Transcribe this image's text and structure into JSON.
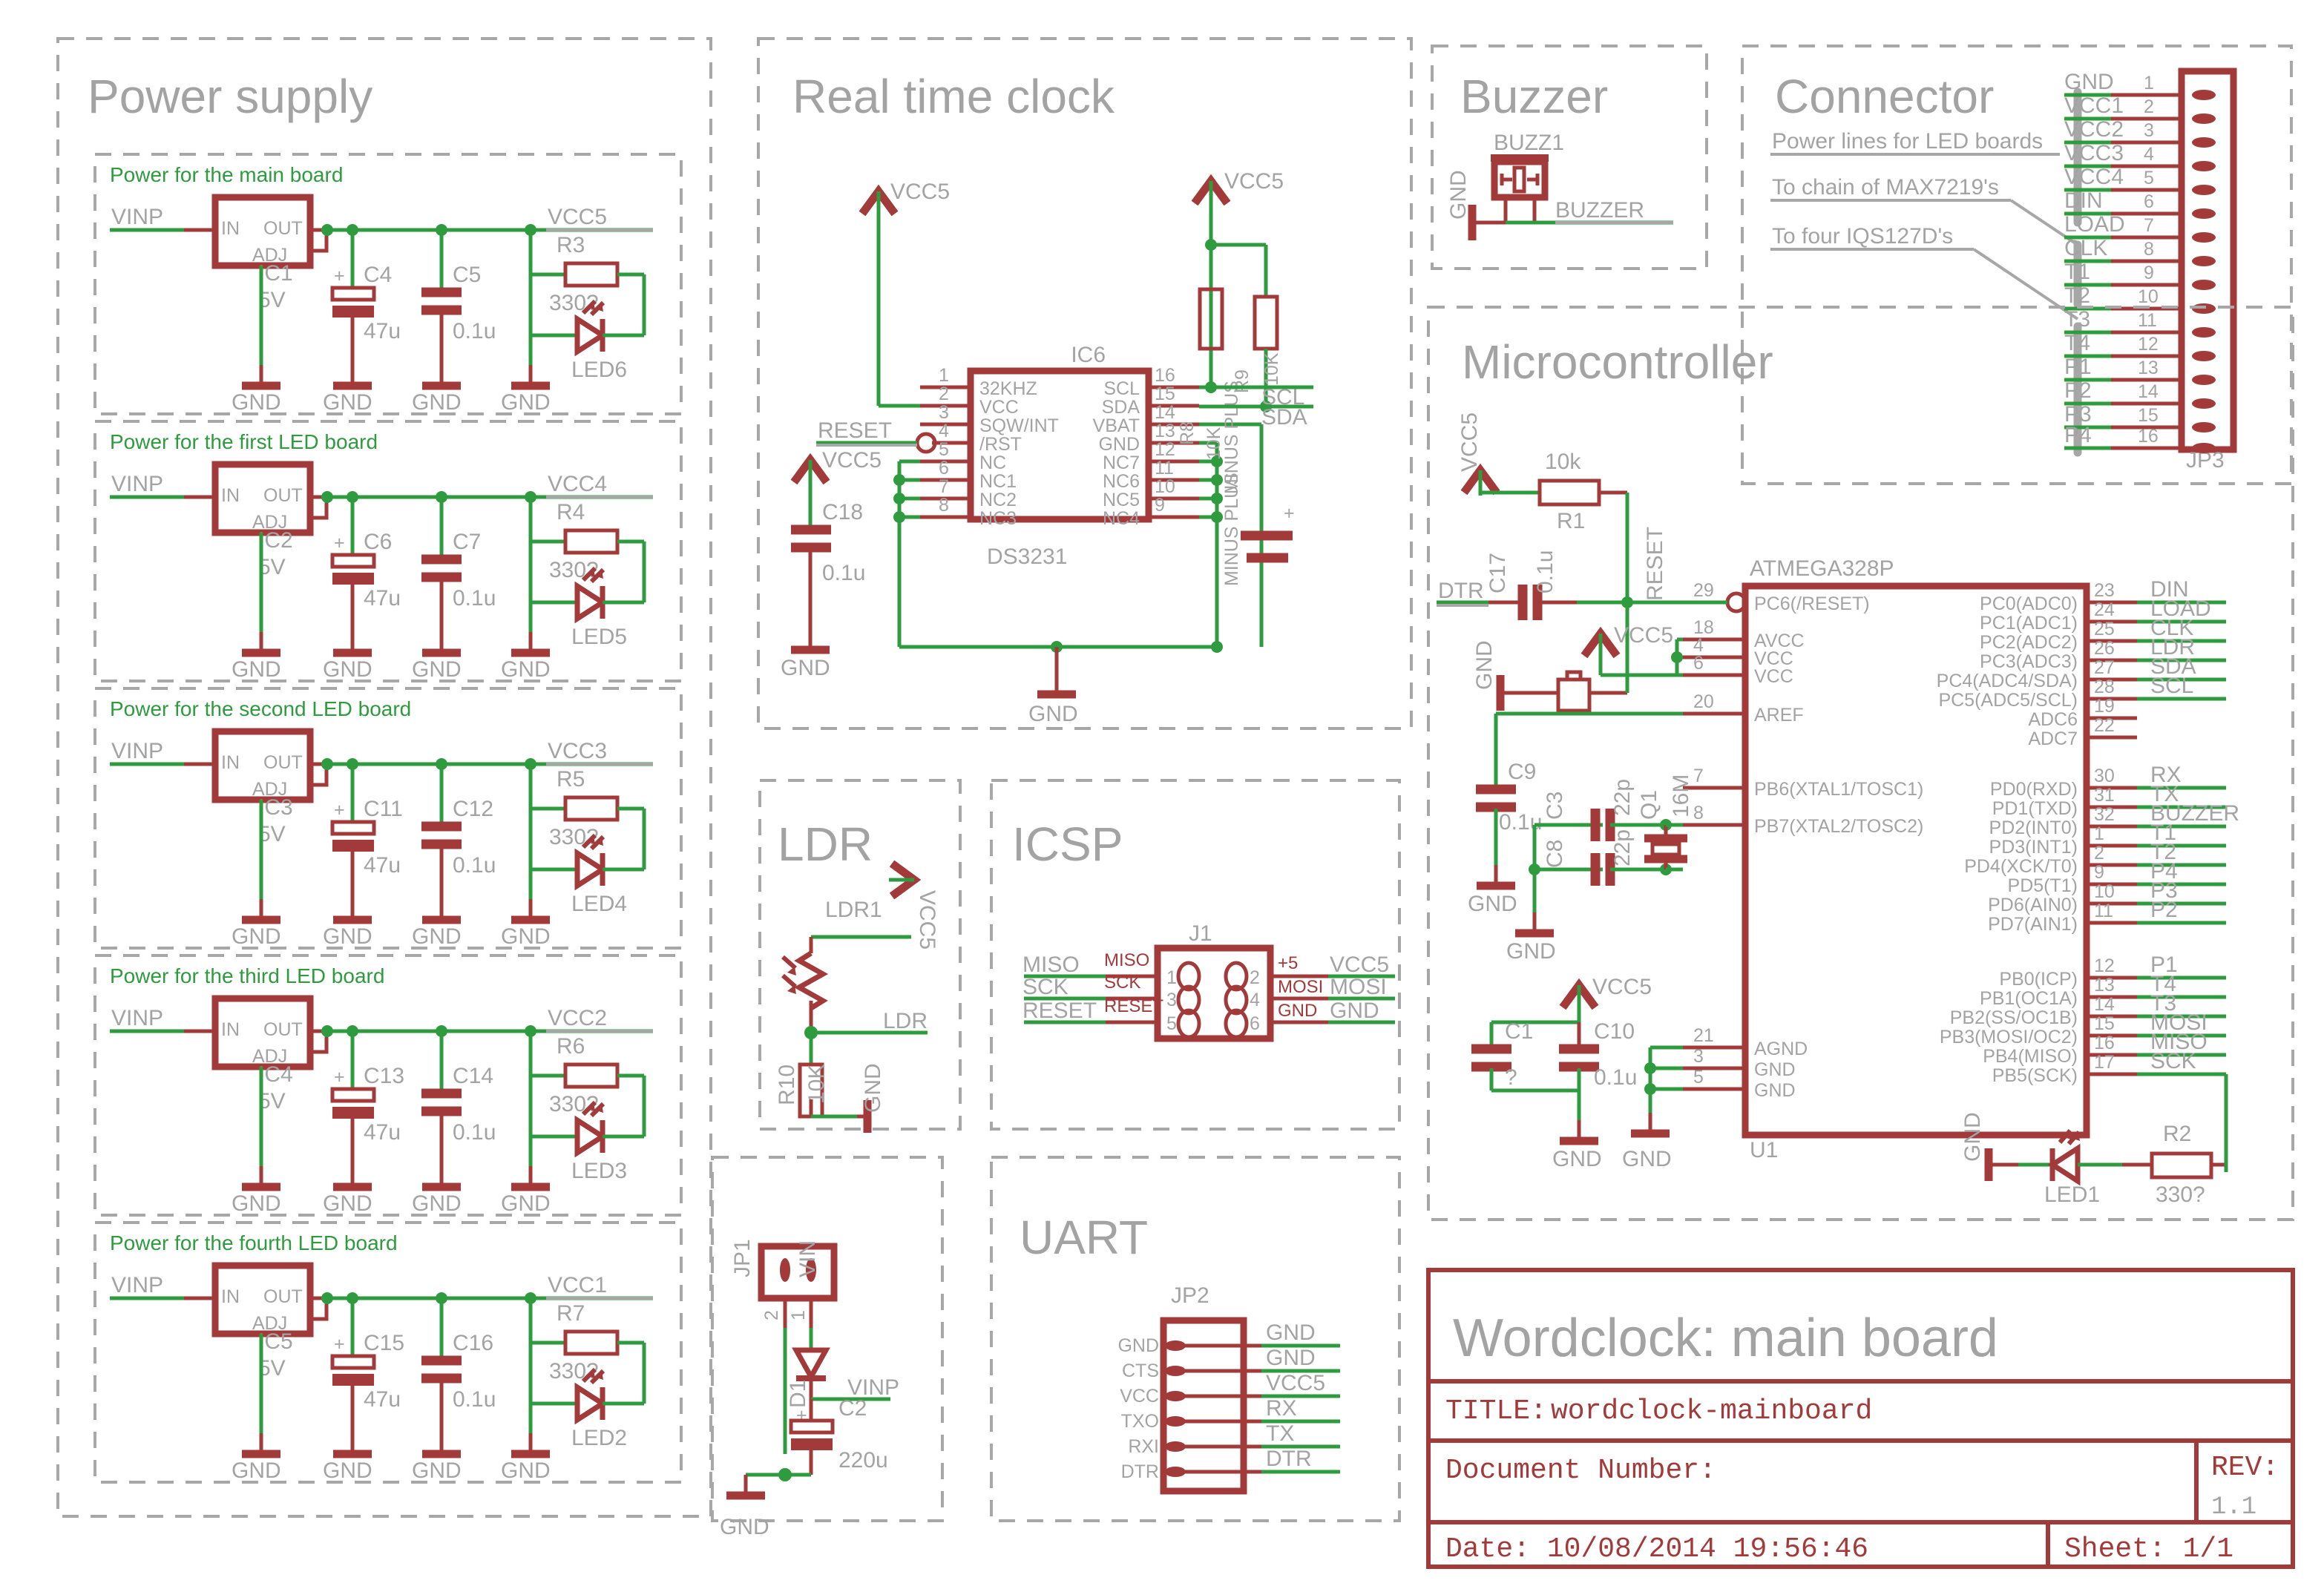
{
  "sheet": {
    "title_big": "Wordclock: main board",
    "title_label": "TITLE:",
    "title_value": "wordclock-mainboard",
    "docnum_label": "Document Number:",
    "rev_label": "REV:",
    "rev_value": "1.1",
    "date_line": "Date: 10/08/2014 19:56:46",
    "sheet_line": "Sheet: 1/1"
  },
  "colors": {
    "wire_red": "#a23a3a",
    "wire_green": "#2e9b3e",
    "text_gray": "#a3a3a3",
    "frame_dash": "#a7a7a7"
  },
  "sections": {
    "power_supply": "Power supply",
    "real_time_clock": "Real time clock",
    "buzzer": "Buzzer",
    "connector": "Connector",
    "microcontroller": "Microcontroller",
    "ldr": "LDR",
    "icsp": "ICSP",
    "uart": "UART"
  },
  "power_blocks": [
    {
      "caption": "Power for the main board",
      "in": "VINP",
      "out": "VCC5",
      "ic": "IC1",
      "icv": "5V",
      "cbig": "C4",
      "cbigv": "47u",
      "csm": "C5",
      "csmv": "0.1u",
      "r": "R3",
      "rv": "330?",
      "led": "LED6",
      "gnd": "GND"
    },
    {
      "caption": "Power for the first LED board",
      "in": "VINP",
      "out": "VCC4",
      "ic": "IC2",
      "icv": "5V",
      "cbig": "C6",
      "cbigv": "47u",
      "csm": "C7",
      "csmv": "0.1u",
      "r": "R4",
      "rv": "330?",
      "led": "LED5",
      "gnd": "GND"
    },
    {
      "caption": "Power for the second LED board",
      "in": "VINP",
      "out": "VCC3",
      "ic": "IC3",
      "icv": "5V",
      "cbig": "C11",
      "cbigv": "47u",
      "csm": "C12",
      "csmv": "0.1u",
      "r": "R5",
      "rv": "330?",
      "led": "LED4",
      "gnd": "GND"
    },
    {
      "caption": "Power for the third LED board",
      "in": "VINP",
      "out": "VCC2",
      "ic": "IC4",
      "icv": "5V",
      "cbig": "C13",
      "cbigv": "47u",
      "csm": "C14",
      "csmv": "0.1u",
      "r": "R6",
      "rv": "330?",
      "led": "LED3",
      "gnd": "GND"
    },
    {
      "caption": "Power for the fourth LED board",
      "in": "VINP",
      "out": "VCC1",
      "ic": "IC5",
      "icv": "5V",
      "cbig": "C15",
      "cbigv": "47u",
      "csm": "C16",
      "csmv": "0.1u",
      "r": "R7",
      "rv": "330?",
      "led": "LED2",
      "gnd": "GND"
    }
  ],
  "regulator_pins": {
    "in": "IN",
    "out": "OUT",
    "adj": "ADJ"
  },
  "rtc": {
    "ref": "IC6",
    "part": "DS3231",
    "vcc_top": "VCC5",
    "vcc_left": "VCC5",
    "vcc_cap": "VCC5",
    "reset": "RESET",
    "cap": "C18",
    "capv": "0.1u",
    "gnd": "GND",
    "gnd2": "GND",
    "r8": "R8",
    "r8v": "10K",
    "r9": "R9",
    "r9v": "10K",
    "scl": "SCL",
    "sda": "SDA",
    "bat_plus": "MINUS PLUS",
    "bat_minus": "MINUS PLUS",
    "left_pins": [
      {
        "n": "1",
        "name": "32KHZ"
      },
      {
        "n": "2",
        "name": "VCC"
      },
      {
        "n": "3",
        "name": "SQW/INT"
      },
      {
        "n": "4",
        "name": "/RST"
      },
      {
        "n": "5",
        "name": "NC"
      },
      {
        "n": "6",
        "name": "NC1"
      },
      {
        "n": "7",
        "name": "NC2"
      },
      {
        "n": "8",
        "name": "NC3"
      }
    ],
    "right_pins": [
      {
        "n": "16",
        "name": "SCL"
      },
      {
        "n": "15",
        "name": "SDA"
      },
      {
        "n": "14",
        "name": "VBAT"
      },
      {
        "n": "13",
        "name": "GND"
      },
      {
        "n": "12",
        "name": "NC7"
      },
      {
        "n": "11",
        "name": "NC6"
      },
      {
        "n": "10",
        "name": "NC5"
      },
      {
        "n": "9",
        "name": "NC4"
      }
    ]
  },
  "buzzer": {
    "ref": "BUZZ1",
    "gnd": "GND",
    "net": "BUZZER"
  },
  "connector": {
    "ref": "JP3",
    "notes": [
      "Power lines for LED boards",
      "To chain of MAX7219's",
      "To four IQS127D's"
    ],
    "pins": [
      {
        "name": "GND",
        "n": "1"
      },
      {
        "name": "VCC1",
        "n": "2"
      },
      {
        "name": "VCC2",
        "n": "3"
      },
      {
        "name": "VCC3",
        "n": "4"
      },
      {
        "name": "VCC4",
        "n": "5"
      },
      {
        "name": "DIN",
        "n": "6"
      },
      {
        "name": "LOAD",
        "n": "7"
      },
      {
        "name": "CLK",
        "n": "8"
      },
      {
        "name": "T1",
        "n": "9"
      },
      {
        "name": "T2",
        "n": "10"
      },
      {
        "name": "T3",
        "n": "11"
      },
      {
        "name": "T4",
        "n": "12"
      },
      {
        "name": "P1",
        "n": "13"
      },
      {
        "name": "P2",
        "n": "14"
      },
      {
        "name": "P3",
        "n": "15"
      },
      {
        "name": "P4",
        "n": "16"
      }
    ]
  },
  "mcu": {
    "ref": "U1",
    "part": "ATMEGA328P",
    "reset_net": "RESET",
    "dtr_net": "DTR",
    "vcc_reset": "VCC5",
    "vcc_supply": "VCC5",
    "vcc_xtal": "VCC5",
    "vcc_decouple": "VCC5",
    "r1": "R1",
    "r1v": "10k",
    "c17": "C17",
    "c17v": "0.1u",
    "gnd_r1": "GND",
    "c9": "C9",
    "c9v": "0.1u",
    "c3": "C3",
    "c3v": "22p",
    "c8": "C8",
    "c8v": "22p",
    "q1": "Q1",
    "q1v": "16M",
    "gnd_c9": "GND",
    "gnd_xtal": "GND",
    "c1": "C1",
    "c1v": "?",
    "c10": "C10",
    "c10v": "0.1u",
    "gnd_c10": "GND",
    "gnd_agnd": "GND",
    "r2": "R2",
    "r2v": "330?",
    "led1": "LED1",
    "gnd_led1": "GND",
    "left_pins": [
      {
        "n": "29",
        "name": "PC6(/RESET)",
        "inv": true
      },
      {
        "n": "18",
        "name": "AVCC"
      },
      {
        "n": "4",
        "name": "VCC"
      },
      {
        "n": "6",
        "name": "VCC"
      },
      {
        "n": "20",
        "name": "AREF"
      },
      {
        "n": "7",
        "name": "PB6(XTAL1/TOSC1)"
      },
      {
        "n": "8",
        "name": "PB7(XTAL2/TOSC2)"
      },
      {
        "n": "21",
        "name": "AGND"
      },
      {
        "n": "3",
        "name": "GND"
      },
      {
        "n": "5",
        "name": "GND"
      }
    ],
    "right_pins": [
      {
        "n": "23",
        "name": "PC0(ADC0)",
        "net": "DIN"
      },
      {
        "n": "24",
        "name": "PC1(ADC1)",
        "net": "LOAD"
      },
      {
        "n": "25",
        "name": "PC2(ADC2)",
        "net": "CLK"
      },
      {
        "n": "26",
        "name": "PC3(ADC3)",
        "net": "LDR"
      },
      {
        "n": "27",
        "name": "PC4(ADC4/SDA)",
        "net": "SDA"
      },
      {
        "n": "28",
        "name": "PC5(ADC5/SCL)",
        "net": "SCL"
      },
      {
        "n": "19",
        "name": "ADC6",
        "net": ""
      },
      {
        "n": "22",
        "name": "ADC7",
        "net": ""
      },
      {
        "n": "30",
        "name": "PD0(RXD)",
        "net": "RX"
      },
      {
        "n": "31",
        "name": "PD1(TXD)",
        "net": "TX"
      },
      {
        "n": "32",
        "name": "PD2(INT0)",
        "net": "BUZZER"
      },
      {
        "n": "1",
        "name": "PD3(INT1)",
        "net": "T1"
      },
      {
        "n": "2",
        "name": "PD4(XCK/T0)",
        "net": "T2"
      },
      {
        "n": "9",
        "name": "PD5(T1)",
        "net": "P4"
      },
      {
        "n": "10",
        "name": "PD6(AIN0)",
        "net": "P3"
      },
      {
        "n": "11",
        "name": "PD7(AIN1)",
        "net": "P2"
      },
      {
        "n": "12",
        "name": "PB0(ICP)",
        "net": "P1"
      },
      {
        "n": "13",
        "name": "PB1(OC1A)",
        "net": "T4"
      },
      {
        "n": "14",
        "name": "PB2(SS/OC1B)",
        "net": "T3"
      },
      {
        "n": "15",
        "name": "PB3(MOSI/OC2)",
        "net": "MOSI"
      },
      {
        "n": "16",
        "name": "PB4(MISO)",
        "net": "MISO"
      },
      {
        "n": "17",
        "name": "PB5(SCK)",
        "net": "SCK"
      }
    ]
  },
  "ldr": {
    "ref": "LDR1",
    "vcc": "VCC5",
    "net": "LDR",
    "r": "R10",
    "rv": "10K",
    "gnd": "GND"
  },
  "icsp": {
    "ref": "J1",
    "rows": [
      {
        "lnet": "MISO",
        "lpin": "MISO",
        "ln": "1",
        "rn": "2",
        "rpin": "+5",
        "rnet": "VCC5"
      },
      {
        "lnet": "SCK",
        "lpin": "SCK",
        "ln": "3",
        "rn": "4",
        "rpin": "MOSI",
        "rnet": "MOSI"
      },
      {
        "lnet": "RESET",
        "lpin": "RESET",
        "ln": "5",
        "rn": "6",
        "rpin": "GND",
        "rnet": "GND"
      }
    ]
  },
  "uart": {
    "ref": "JP2",
    "rows": [
      {
        "pin": "GND",
        "net": "GND"
      },
      {
        "pin": "CTS",
        "net": "GND"
      },
      {
        "pin": "VCC",
        "net": "VCC5"
      },
      {
        "pin": "TXO",
        "net": "RX"
      },
      {
        "pin": "RXI",
        "net": "TX"
      },
      {
        "pin": "DTR",
        "net": "DTR"
      }
    ]
  },
  "powerin": {
    "ref": "JP1",
    "vin": "VIN",
    "p1": "1",
    "p2": "2",
    "d1": "D1",
    "c2": "C2",
    "c2v": "220u",
    "net": "VINP",
    "gnd": "GND"
  }
}
